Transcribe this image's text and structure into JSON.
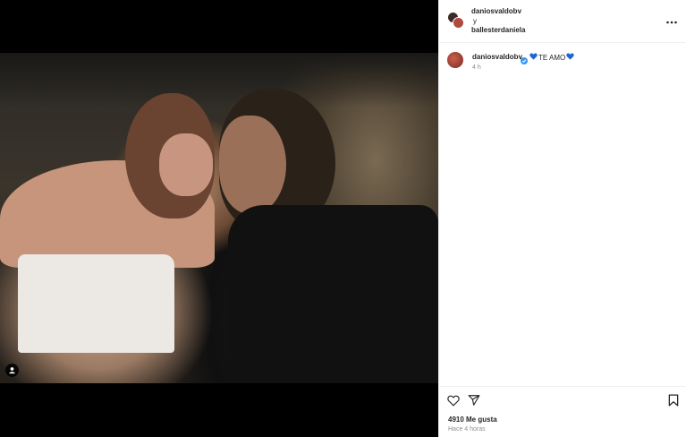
{
  "post": {
    "photo_alt": "",
    "tag_icon": "person-tag-icon"
  },
  "header": {
    "author": "daniosvaldobv",
    "conjunction": "y",
    "collaborator": "ballesterdaniela",
    "more_icon": "more-horizontal-icon"
  },
  "caption": {
    "username": "daniosvaldobv",
    "verified_icon": "verified-badge-icon",
    "text": "TE AMO",
    "emoji": "blue-heart-icon",
    "time": "4 h"
  },
  "actions": {
    "like_icon": "heart-outline-icon",
    "share_icon": "paper-plane-icon",
    "save_icon": "bookmark-icon",
    "likes": "4910 Me gusta",
    "timestamp": "Hace 4 horas"
  },
  "colors": {
    "verified": "#3897f0",
    "heart": "#1d64d6"
  }
}
